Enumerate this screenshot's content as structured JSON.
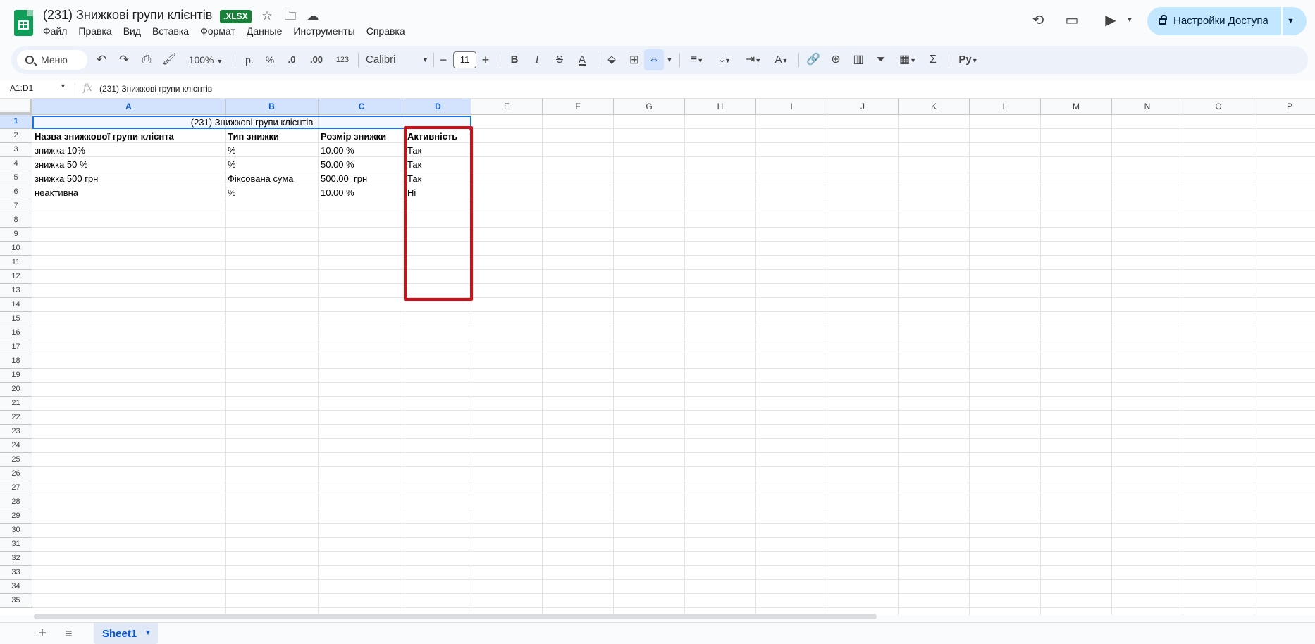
{
  "document": {
    "title": "(231) Знижкові групи клієнтів",
    "badge": ".XLSX"
  },
  "menu": [
    "Файл",
    "Правка",
    "Вид",
    "Вставка",
    "Формат",
    "Данные",
    "Инструменты",
    "Справка"
  ],
  "share": {
    "label": "Настройки Доступа"
  },
  "toolbar": {
    "search_label": "Меню",
    "zoom": "100%",
    "currency": "р.",
    "percent": "%",
    "dec_decrease": ".0",
    "dec_increase": ".00",
    "number_format": "123",
    "font": "Calibri",
    "font_size": "11",
    "bold": "B",
    "italic": "I",
    "strike": "S",
    "text_color": "A",
    "function": "Σ"
  },
  "formula_bar": {
    "name_box": "A1:D1",
    "fx": "fx",
    "content": "(231) Знижкові групи клієнтів"
  },
  "columns": [
    "A",
    "B",
    "C",
    "D",
    "E",
    "F",
    "G",
    "H",
    "I",
    "J",
    "K",
    "L",
    "M",
    "N",
    "O",
    "P"
  ],
  "rows": [
    "1",
    "2",
    "3",
    "4",
    "5",
    "6",
    "7",
    "8",
    "9",
    "10",
    "11",
    "12",
    "13",
    "14",
    "15",
    "16",
    "17",
    "18",
    "19",
    "20",
    "21",
    "22",
    "23",
    "24",
    "25",
    "26",
    "27",
    "28",
    "29",
    "30",
    "31",
    "32",
    "33",
    "34",
    "35"
  ],
  "cells": {
    "title": "(231) Знижкові групи клієнтів",
    "header": [
      "Назва знижкової групи клієнта",
      "Тип знижки",
      "Розмір знижки",
      "Активність"
    ],
    "data": [
      [
        "знижка 10%",
        "%",
        "10.00 %",
        "Так"
      ],
      [
        "знижка 50 %",
        "%",
        "50.00 %",
        "Так"
      ],
      [
        "знижка 500 грн",
        "Фіксована сума",
        "500.00  грн",
        "Так"
      ],
      [
        "неактивна",
        "%",
        "10.00 %",
        "Ні"
      ]
    ]
  },
  "sheets": [
    {
      "name": "Sheet1",
      "active": true
    }
  ],
  "colors": {
    "highlight_box": "#d40e14",
    "selection": "#1a73e8",
    "accent": "#0b57d0"
  }
}
